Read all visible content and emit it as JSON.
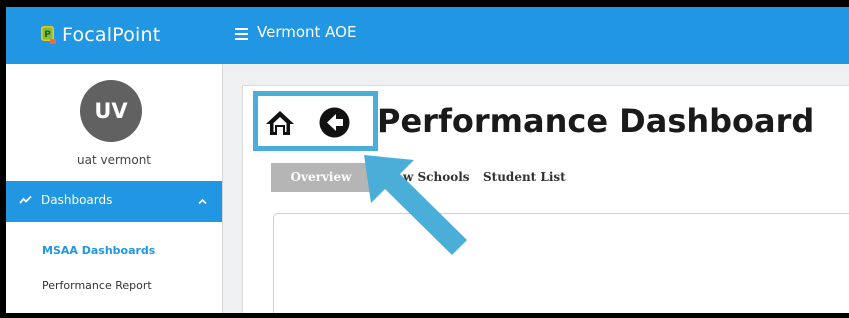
{
  "colors": {
    "brand_blue": "#2196e3",
    "avatar_bg": "#616161",
    "annotation_blue": "#4aaed9",
    "tab_active_bg": "#b5b5b5"
  },
  "header": {
    "logo_text": "FocalPoint",
    "logo_icon": "focalpoint-logo-icon",
    "menu_icon": "hamburger-menu-icon",
    "org_title": "Vermont AOE"
  },
  "sidebar": {
    "avatar_initials": "UV",
    "user_name": "uat vermont",
    "section": {
      "label": "Dashboards",
      "icon": "trend-line-icon",
      "chevron": "chevron-up-icon"
    },
    "items": [
      {
        "label": "MSAA Dashboards",
        "active": true
      },
      {
        "label": "Performance Report",
        "active": false
      }
    ]
  },
  "main": {
    "page_title": "Performance Dashboard",
    "home_icon": "home-icon",
    "back_icon": "back-arrow-icon",
    "tabs": [
      {
        "label": "Overview",
        "active": true
      },
      {
        "label": "w Schools",
        "active": false
      },
      {
        "label": "Student List",
        "active": false
      }
    ]
  },
  "annotation": {
    "highlight": "highlight-box",
    "arrow": "pointer-arrow"
  }
}
